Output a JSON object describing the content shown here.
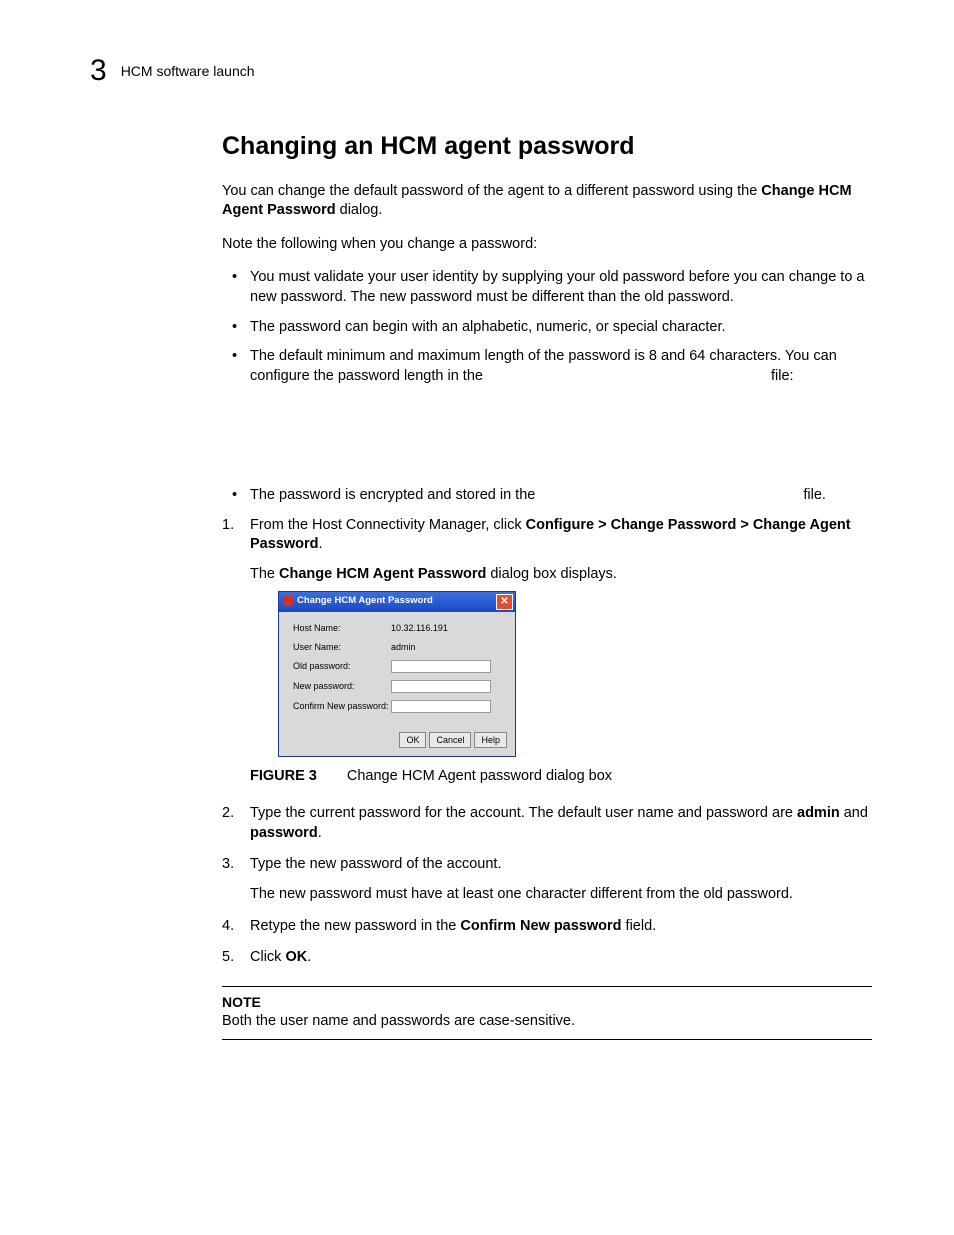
{
  "header": {
    "chapter_number": "3",
    "running_title": "HCM software launch"
  },
  "section_title": "Changing an HCM agent password",
  "intro": {
    "p1_a": "You can change the default password of the agent to a different password using the ",
    "p1_bold": "Change HCM Agent Password",
    "p1_b": " dialog.",
    "p2": "Note the following when you change a password:"
  },
  "bullets": {
    "b1": "You must validate your user identity by supplying your old password before you can change to a new password. The new password must be different than the old password.",
    "b2": "The password can begin with an alphabetic, numeric, or special character.",
    "b3_a": "The default minimum and maximum length of the password is 8 and 64 characters. You can configure the password length in the ",
    "b3_b": " file:",
    "b4_a": "The password is encrypted and stored in the ",
    "b4_b": " file."
  },
  "steps": {
    "s1_a": "From the Host Connectivity Manager, click ",
    "s1_bold": "Configure > Change Password > Change Agent Password",
    "s1_b": ".",
    "s1_sub_a": "The ",
    "s1_sub_bold": "Change HCM Agent Password",
    "s1_sub_b": " dialog box displays.",
    "s2_a": "Type the current password for the account. The default user name and password are ",
    "s2_bold1": "admin",
    "s2_mid": " and ",
    "s2_bold2": "password",
    "s2_b": ".",
    "s3": "Type the new password of the account.",
    "s3_sub": "The new password must have at least one character different from the old password.",
    "s4_a": "Retype the new password in the ",
    "s4_bold": "Confirm New password",
    "s4_b": " field.",
    "s5_a": "Click ",
    "s5_bold": "OK",
    "s5_b": "."
  },
  "figure": {
    "label": "FIGURE 3",
    "caption": "Change HCM Agent password dialog box"
  },
  "dialog": {
    "title": "Change HCM Agent Password",
    "rows": {
      "host_label": "Host Name:",
      "host_value": "10.32.116.191",
      "user_label": "User Name:",
      "user_value": "admin",
      "oldpw_label": "Old password:",
      "newpw_label": "New password:",
      "confirm_label": "Confirm New password:"
    },
    "buttons": {
      "ok": "OK",
      "cancel": "Cancel",
      "help": "Help"
    }
  },
  "note": {
    "label": "NOTE",
    "body": "Both the user name and passwords are case-sensitive."
  }
}
